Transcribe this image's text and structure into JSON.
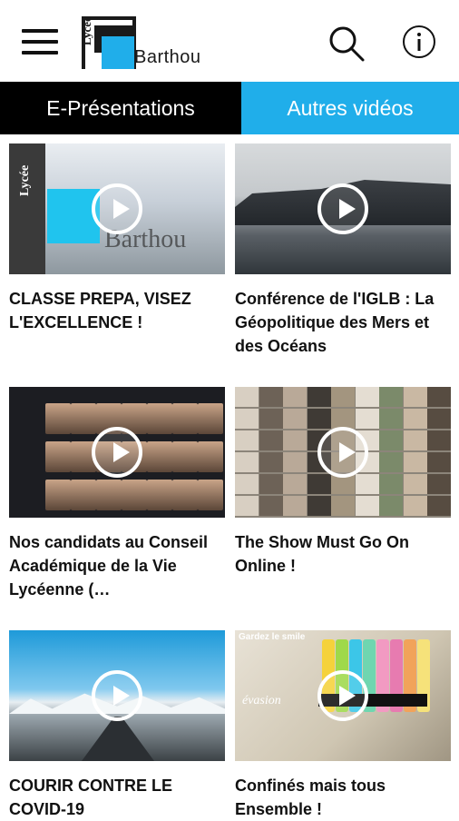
{
  "header": {
    "logo": {
      "vertical_text": "Lycée",
      "name": "Barthou"
    },
    "menu_icon": "hamburger-icon",
    "search_icon": "search-icon",
    "info_icon": "info-icon"
  },
  "tabs": [
    {
      "label": "E-Présentations",
      "active": false
    },
    {
      "label": "Autres vidéos",
      "active": true
    }
  ],
  "videos": [
    {
      "title": "CLASSE PREPA, VISEZ L'EXCELLENCE !"
    },
    {
      "title": "Conférence de l'IGLB : La Géopolitique des Mers et des Océans"
    },
    {
      "title": "Nos candidats au Conseil Académique de la Vie Lycéenne (…"
    },
    {
      "title": "The Show Must Go On Online !"
    },
    {
      "title": "COURIR CONTRE LE COVID-19"
    },
    {
      "title": "Confinés mais tous Ensemble !"
    }
  ],
  "thumb_text": {
    "v1_logo_word": "Barthou",
    "v1_vertical": "Lycée",
    "v6_label": "Gardez le smile",
    "v6_word": "évasion"
  },
  "colors": {
    "accent": "#20aeea",
    "tab_dark": "#000000"
  }
}
